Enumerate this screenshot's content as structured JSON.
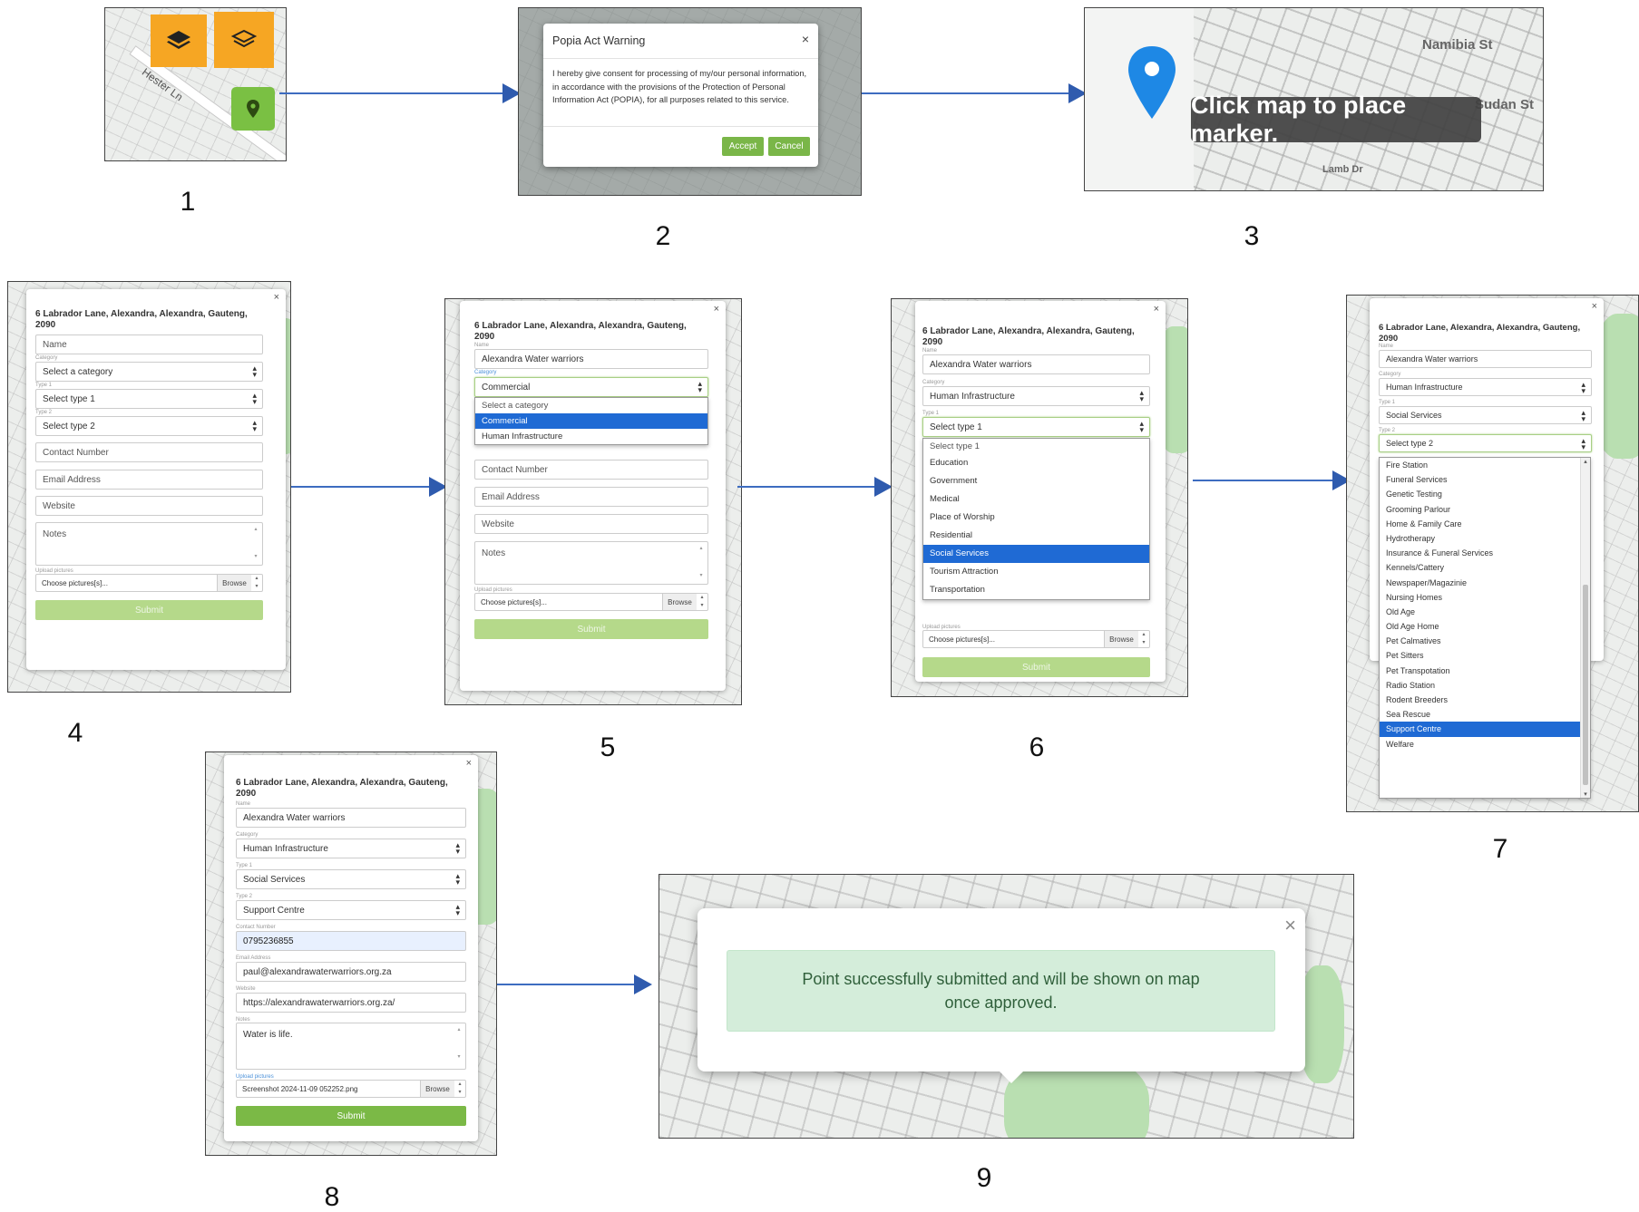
{
  "step_numbers": [
    "1",
    "2",
    "3",
    "4",
    "5",
    "6",
    "7",
    "8",
    "9"
  ],
  "step1": {
    "road_label": "Hester Ln",
    "layer_icon": "layers-icon",
    "layer_outline_icon": "layers-outline-icon",
    "marker_icon": "map-marker-icon"
  },
  "step2": {
    "title": "Popia Act Warning",
    "close": "×",
    "body": "I hereby give consent for processing of my/our personal information, in accordance with the provisions of the Protection of Personal Information Act (POPIA), for all purposes related to this service.",
    "accept": "Accept",
    "cancel": "Cancel"
  },
  "step3": {
    "tooltip": "Click map to place marker.",
    "streets": [
      "Namibia St",
      "Sudan St",
      "Lamb Dr"
    ],
    "marker_color": "#1e88e5"
  },
  "form": {
    "address": "6 Labrador Lane, Alexandra, Alexandra, Gauteng, 2090",
    "close": "×",
    "labels": {
      "name": "Name",
      "category": "Category",
      "type1": "Type 1",
      "type2": "Type 2",
      "contact": "Contact Number",
      "email": "Email Address",
      "website": "Website",
      "notes": "Notes",
      "upload": "Upload pictures"
    },
    "placeholders": {
      "name": "Name",
      "category": "Select a category",
      "type1": "Select type 1",
      "type2": "Select type 2",
      "contact": "Contact Number",
      "email": "Email Address",
      "website": "Website",
      "notes": "Notes",
      "file": "Choose pictures[s]..."
    },
    "browse": "Browse",
    "submit": "Submit"
  },
  "values": {
    "name": "Alexandra Water warriors",
    "category_commercial": "Commercial",
    "category": "Human Infrastructure",
    "type1": "Social Services",
    "type2": "Support Centre",
    "contact": "0795236855",
    "email": "paul@alexandrawaterwarriors.org.za",
    "website": "https://alexandrawaterwarriors.org.za/",
    "notes": "Water is life.",
    "file": "Screenshot 2024-11-09 052252.png"
  },
  "category_options": [
    "Select a category",
    "Commercial",
    "Human Infrastructure"
  ],
  "type1_options": [
    "Select type 1",
    "Education",
    "Government",
    "Medical",
    "Place of Worship",
    "Residential",
    "Social Services",
    "Tourism Attraction",
    "Transportation"
  ],
  "type2_options": [
    "Fire Station",
    "Funeral Services",
    "Genetic Testing",
    "Grooming Parlour",
    "Home & Family Care",
    "Hydrotherapy",
    "Insurance & Funeral Services",
    "Kennels/Cattery",
    "Newspaper/Magazinie",
    "Nursing Homes",
    "Old Age",
    "Old Age Home",
    "Pet Calmatives",
    "Pet Sitters",
    "Pet Transpotation",
    "Radio Station",
    "Rodent Breeders",
    "Sea Rescue",
    "Support Centre",
    "Welfare"
  ],
  "step9": {
    "message": "Point successfully submitted and will be shown on map once approved.",
    "close": "×"
  },
  "colors": {
    "arrow": "#3d6cc0",
    "accent_green": "#7bb946",
    "orange": "#f6a623",
    "selected_blue": "#1f6ad4"
  }
}
